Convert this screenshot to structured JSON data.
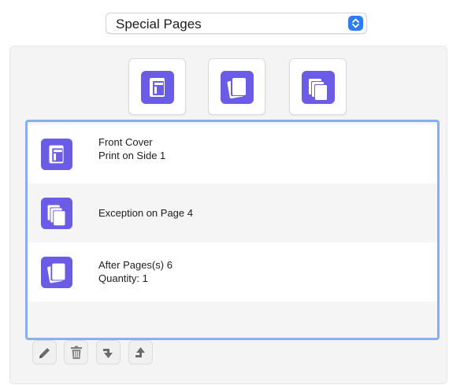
{
  "popup": {
    "selected": "Special Pages"
  },
  "type_buttons": [
    {
      "name": "front-cover-type-button",
      "icon": "front-cover-icon"
    },
    {
      "name": "after-pages-type-button",
      "icon": "insert-pages-icon"
    },
    {
      "name": "exception-type-button",
      "icon": "exception-pages-icon"
    }
  ],
  "list": {
    "rows": [
      {
        "icon": "front-cover-icon",
        "line1": "Front Cover",
        "line2": "Print on Side 1"
      },
      {
        "icon": "exception-pages-icon",
        "line1": "Exception on Page 4",
        "line2": ""
      },
      {
        "icon": "insert-pages-icon",
        "line1": "After Pages(s) 6",
        "line2": "Quantity: 1"
      }
    ]
  },
  "toolbar": {
    "edit": "pencil-icon",
    "delete": "trash-icon",
    "move_down": "move-down-icon",
    "move_up": "move-up-icon"
  },
  "colors": {
    "icon_purple": "#6a5ce6",
    "focus_ring": "#86aef3",
    "popup_accent": "#2f7df6"
  }
}
